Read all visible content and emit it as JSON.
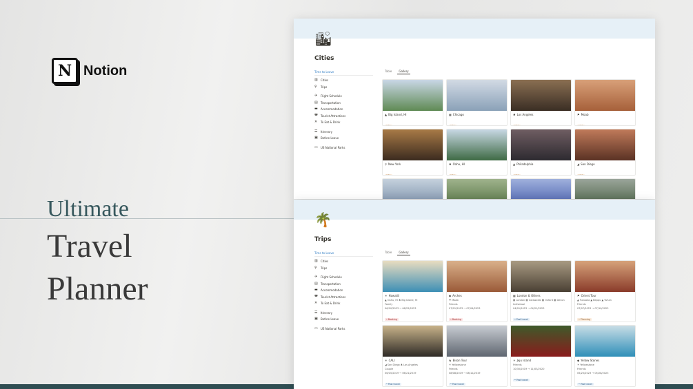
{
  "brand": {
    "name": "Notion",
    "logo_letter": "N"
  },
  "hero": {
    "line1": "Ultimate",
    "line2": "Travel",
    "line3": "Planner"
  },
  "toc": {
    "heading": "Time to Leave",
    "items": [
      {
        "icon": "▥",
        "label": "Cities"
      },
      {
        "icon": "⚲",
        "label": "Trips"
      },
      {
        "sep": true
      },
      {
        "icon": "✈",
        "label": "Flight Schedule"
      },
      {
        "icon": "▤",
        "label": "Transportation"
      },
      {
        "icon": "▬",
        "label": "Accommodation"
      },
      {
        "icon": "◚",
        "label": "Tourist Attractions"
      },
      {
        "icon": "✕",
        "label": "To Eat & Drink"
      },
      {
        "sep": true
      },
      {
        "icon": "☰",
        "label": "Itinerary"
      },
      {
        "icon": "▣",
        "label": "Before Leave"
      },
      {
        "sep": true
      },
      {
        "icon": "▭",
        "label": "US National Parks"
      }
    ]
  },
  "cities": {
    "icon": "🏙",
    "title": "Cities",
    "views": [
      "Table",
      "Gallery"
    ],
    "active_view": "Gallery",
    "cards": [
      {
        "icon": "▲",
        "title": "Big Island, HI",
        "tag": "USA",
        "thumb": "#5f8a54",
        "thumb2": "#c9d7e6"
      },
      {
        "icon": "▦",
        "title": "Chicago",
        "tag": "USA",
        "thumb": "#8aa1b8",
        "thumb2": "#d2dae4"
      },
      {
        "icon": "♣",
        "title": "Los Angeles",
        "tag": "USA",
        "thumb": "#3a2e24",
        "thumb2": "#8a6f52"
      },
      {
        "icon": "⚑",
        "title": "Moab",
        "tag": "USA",
        "thumb": "#a6603a",
        "thumb2": "#d8a079"
      },
      {
        "icon": "⚲",
        "title": "New York",
        "tag": "USA",
        "thumb": "#3b2b1f",
        "thumb2": "#a87a46"
      },
      {
        "icon": "♣",
        "title": "Oahu, HI",
        "tag": "USA",
        "thumb": "#3e6a44",
        "thumb2": "#c8d8e4"
      },
      {
        "icon": "▲",
        "title": "Philadelphia",
        "tag": "USA",
        "thumb": "#2d2a30",
        "thumb2": "#6f5d62"
      },
      {
        "icon": "◢",
        "title": "San Diego",
        "tag": "USA",
        "thumb": "#5a3224",
        "thumb2": "#c07a5a"
      },
      {
        "icon": "",
        "title": "",
        "tag": "",
        "thumb": "#6f86a2",
        "thumb2": "#c5d1dd"
      },
      {
        "icon": "",
        "title": "",
        "tag": "",
        "thumb": "#4d6b3c",
        "thumb2": "#9fb38c"
      },
      {
        "icon": "",
        "title": "",
        "tag": "",
        "thumb": "#3f57a8",
        "thumb2": "#9fb0dc"
      },
      {
        "icon": "",
        "title": "",
        "tag": "",
        "thumb": "#425a3c",
        "thumb2": "#9aa59a"
      }
    ]
  },
  "trips": {
    "icon": "🌴",
    "title": "Trips",
    "views": [
      "Table",
      "Gallery"
    ],
    "active_view": "Gallery",
    "cards": [
      {
        "icon": "☀",
        "title": "Hawaiiii",
        "line1": "▲ Oahu, HI ♣ Big Island, HI",
        "line2": "Family",
        "line3": "06/10/2023 → 06/22/2023",
        "status": "• Booking",
        "status_class": "booking",
        "thumb": "#3d8fb5",
        "thumb2": "#e8dcc0"
      },
      {
        "icon": "◆",
        "title": "Arches",
        "line1": "⚑ Moab",
        "line2": "Friends",
        "line3": "07/01/2023 → 07/04/2023",
        "status": "• Booking",
        "status_class": "booking",
        "thumb": "#9a5a38",
        "thumb2": "#d9b08a"
      },
      {
        "icon": "▦",
        "title": "London & Others",
        "line1": "▦ London ▦ Cotswolds ▦ Oxford ▦ Devon",
        "line2": "Individual",
        "line3": "04/01/2023 → 04/21/2023",
        "status": "• Past travel",
        "status_class": "past",
        "thumb": "#4a4034",
        "thumb2": "#a89a82"
      },
      {
        "icon": "⚑",
        "title": "Orient Tour",
        "line1": "▲ Fukuoka ▲ Beppu ▲ Yufuin",
        "line2": "Friends",
        "line3": "07/07/2023 → 07/10/2023",
        "status": "• Planning",
        "status_class": "planning",
        "thumb": "#8a3b2a",
        "thumb2": "#d6a27a"
      },
      {
        "icon": "☀",
        "title": "CALI",
        "line1": "◢ San Diego ♣ Los Angeles",
        "line2": "Couple",
        "line3": "06/15/2019 → 06/21/2019",
        "status": "• Past travel",
        "status_class": "past",
        "thumb": "#2e2a26",
        "thumb2": "#c8b38a"
      },
      {
        "icon": "♞",
        "title": "Bison Tour",
        "line1": "☀ Yellowstone",
        "line2": "Friends",
        "line3": "08/08/2019 → 08/12/2019",
        "status": "• Past travel",
        "status_class": "past",
        "thumb": "#5f6670",
        "thumb2": "#c8ccd2"
      },
      {
        "icon": "☀",
        "title": "Jeju Island",
        "line1": "Friends",
        "line2": "",
        "line3": "10/30/2019 → 11/03/2020",
        "status": "• Past travel",
        "status_class": "past",
        "thumb": "#8a1c1c",
        "thumb2": "#3e5a2a"
      },
      {
        "icon": "◆",
        "title": "Yellow Stones",
        "line1": "☀ Yellowstone",
        "line2": "Friends",
        "line3": "05/20/2023 → 05/28/2023",
        "status": "• Past travel",
        "status_class": "past",
        "thumb": "#2f8fb8",
        "thumb2": "#c8dde6"
      }
    ]
  }
}
